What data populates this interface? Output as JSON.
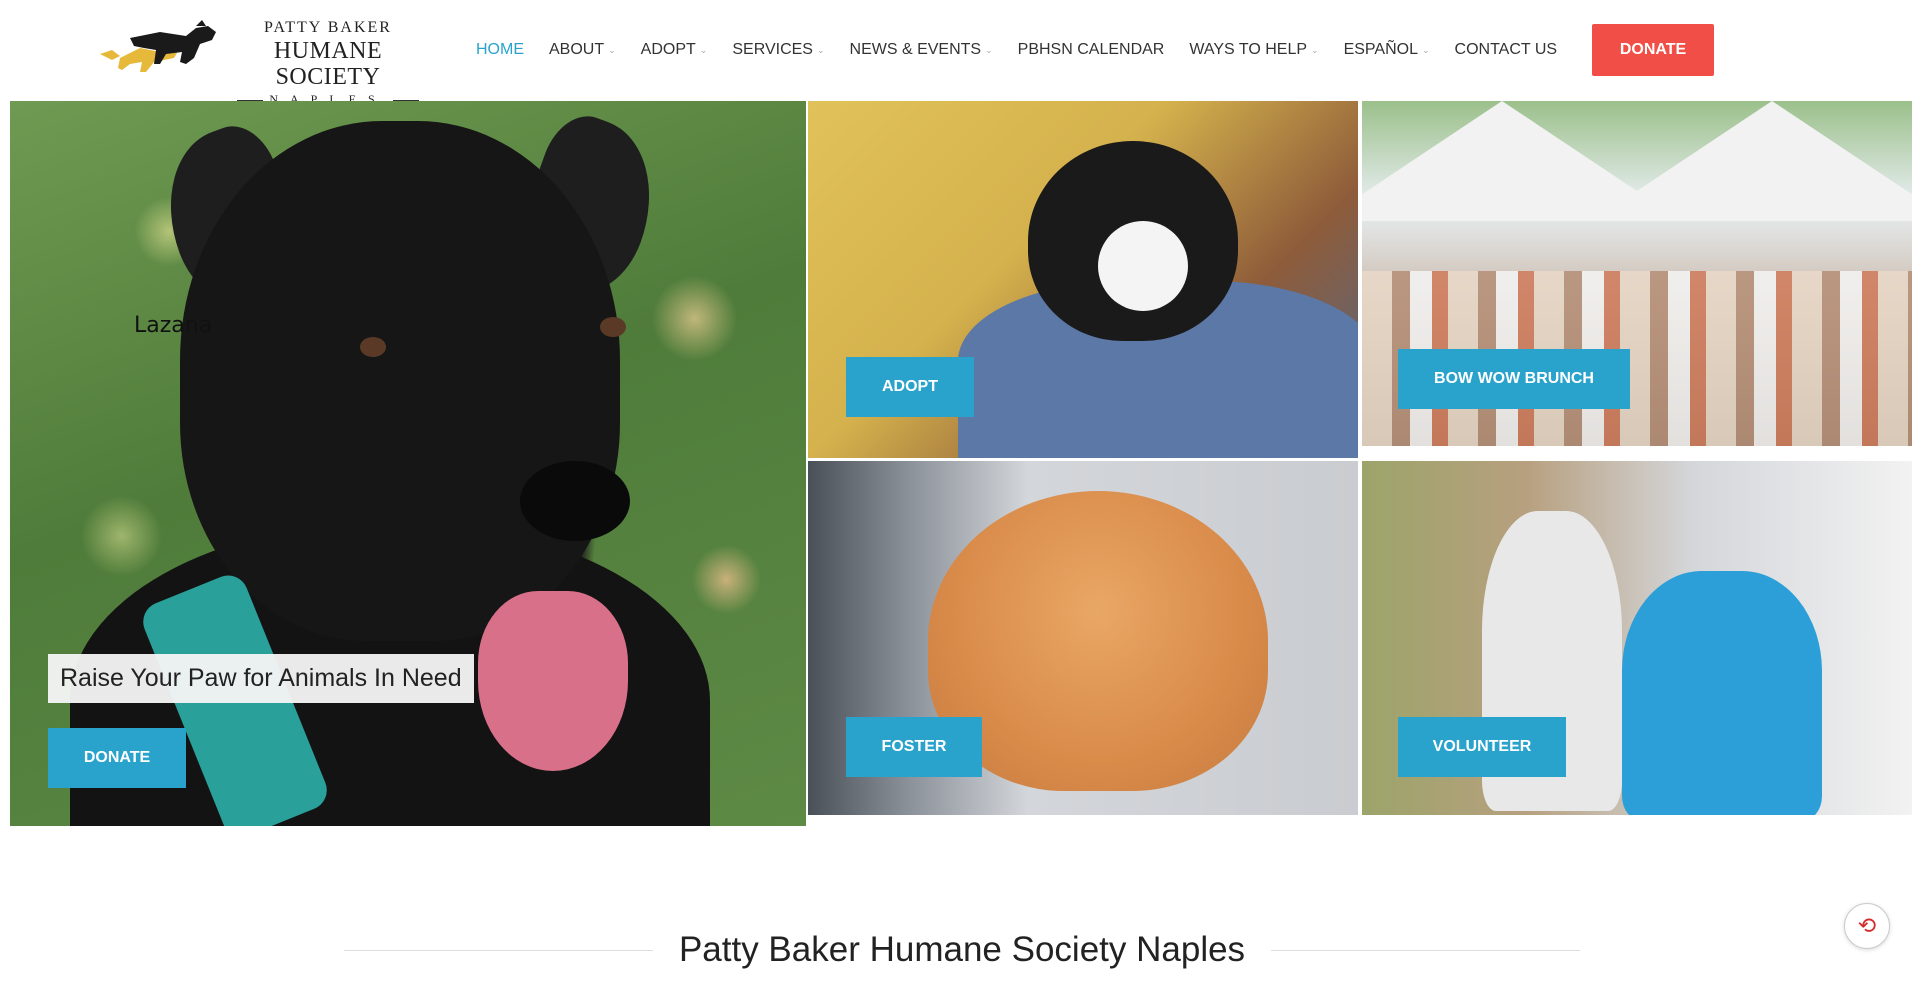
{
  "brand": {
    "line1": "PATTY BAKER",
    "line2": "HUMANE SOCIETY",
    "line3": "NAPLES"
  },
  "nav": {
    "items": [
      {
        "label": "HOME",
        "active": true,
        "has_dropdown": false
      },
      {
        "label": "ABOUT",
        "active": false,
        "has_dropdown": true
      },
      {
        "label": "ADOPT",
        "active": false,
        "has_dropdown": true
      },
      {
        "label": "SERVICES",
        "active": false,
        "has_dropdown": true
      },
      {
        "label": "NEWS & EVENTS",
        "active": false,
        "has_dropdown": true
      },
      {
        "label": "PBHSN CALENDAR",
        "active": false,
        "has_dropdown": false
      },
      {
        "label": "WAYS TO HELP",
        "active": false,
        "has_dropdown": true
      },
      {
        "label": "ESPAÑOL",
        "active": false,
        "has_dropdown": true
      },
      {
        "label": "CONTACT US",
        "active": false,
        "has_dropdown": false
      }
    ],
    "donate_label": "DONATE"
  },
  "hero": {
    "pet_name": "Lazana",
    "caption": "Raise Your Paw for Animals In Need",
    "donate_label": "DONATE"
  },
  "tiles": {
    "adopt_label": "ADOPT",
    "brunch_label": "BOW WOW BRUNCH",
    "foster_label": "FOSTER",
    "volunteer_label": "VOLUNTEER"
  },
  "section": {
    "title": "Patty Baker Humane Society Naples"
  },
  "colors": {
    "accent": "#2aa3cc",
    "donate": "#f04e46",
    "text": "#333333"
  },
  "icons": {
    "pdf": "pdf-icon",
    "caret": "chevron-down-icon"
  }
}
